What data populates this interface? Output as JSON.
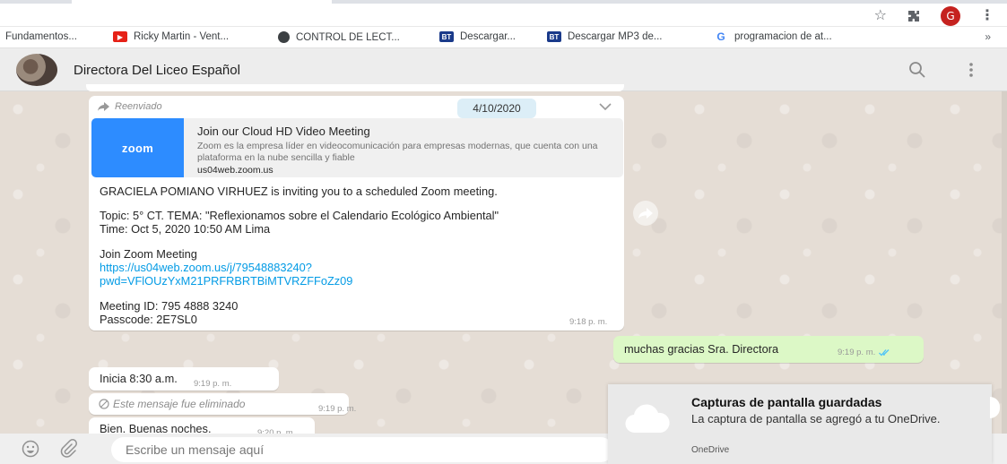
{
  "browser": {
    "profile_initial": "G",
    "bookmarks": [
      {
        "label": "Fundamentos...",
        "icon": "none"
      },
      {
        "label": "Ricky Martin - Vent...",
        "icon": "youtube-icon"
      },
      {
        "label": "CONTROL DE LECT...",
        "icon": "site-icon"
      },
      {
        "label": "Descargar...",
        "icon": "bt-icon"
      },
      {
        "label": "Descargar MP3 de...",
        "icon": "bt-icon"
      },
      {
        "label": "programacion de at...",
        "icon": "google-icon"
      }
    ],
    "bookmarks_more": "»"
  },
  "chat": {
    "title": "Directora Del Liceo Español"
  },
  "forwarded_message": {
    "forwarded_label": "Reenviado",
    "date_chip": "4/10/2020",
    "preview": {
      "logo_text": "zoom",
      "title": "Join our Cloud HD Video Meeting",
      "description": "Zoom es la empresa líder en videocomunicación para empresas modernas, que cuenta con una plataforma en la nube sencilla y fiable",
      "url": "us04web.zoom.us"
    },
    "lines": {
      "invite": "GRACIELA POMIANO VIRHUEZ is inviting you to a scheduled Zoom meeting.",
      "topic": "Topic: 5° CT. TEMA: \"Reflexionamos sobre el Calendario Ecológico Ambiental\"",
      "time": "Time: Oct 5, 2020 10:50 AM Lima",
      "join_heading": "Join Zoom Meeting",
      "link_line1": "https://us04web.zoom.us/j/79548883240?",
      "link_line2": "pwd=VFlOUzYxM21PRFRBRTBiMTVRZFFoZz09",
      "meeting_id": "Meeting ID: 795 4888 3240",
      "passcode": "Passcode: 2E7SL0"
    },
    "timestamp": "9:18 p. m."
  },
  "outgoing_message": {
    "text": "muchas gracias Sra. Directora",
    "timestamp": "9:19 p. m."
  },
  "incoming_messages": [
    {
      "text": "Inicia 8:30 a.m.",
      "timestamp": "9:19 p. m."
    },
    {
      "text": "Este mensaje fue eliminado",
      "timestamp": "9:19 p. m.",
      "deleted": true
    },
    {
      "text": "Bien. Buenas noches.",
      "timestamp": "9:20 p. m."
    }
  ],
  "composer": {
    "placeholder": "Escribe un mensaje aquí"
  },
  "toast": {
    "title": "Capturas de pantalla guardadas",
    "body": "La captura de pantalla se agregó a tu OneDrive.",
    "source": "OneDrive"
  },
  "colors": {
    "chat_background": "#e5ddd5",
    "outgoing_bubble": "#dcf8c6",
    "link": "#039be5",
    "zoom_blue": "#2d8cff",
    "read_ticks": "#4fc3f7"
  }
}
